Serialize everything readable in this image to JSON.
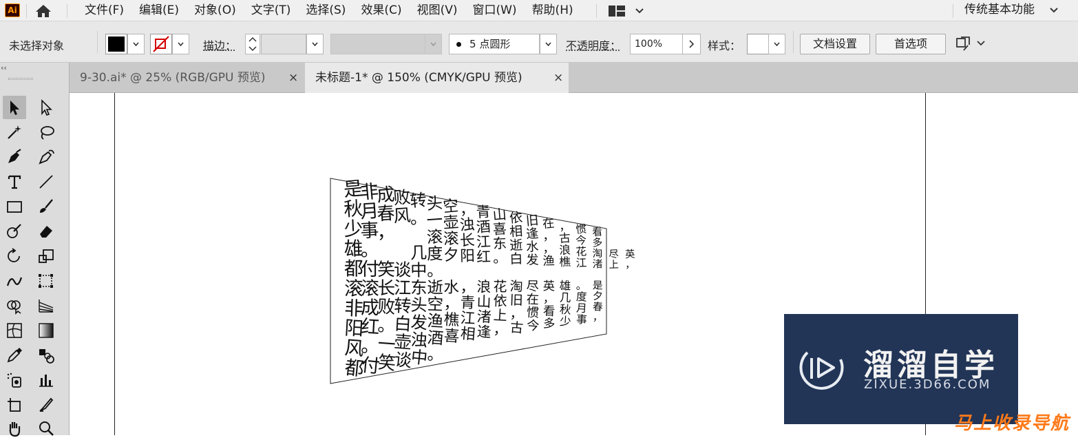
{
  "app": {
    "logo_text": "Ai"
  },
  "menu": {
    "items": [
      "文件(F)",
      "编辑(E)",
      "对象(O)",
      "文字(T)",
      "选择(S)",
      "效果(C)",
      "视图(V)",
      "窗口(W)",
      "帮助(H)"
    ],
    "workspace": "传统基本功能"
  },
  "control": {
    "selection_status": "未选择对象",
    "stroke_label": "描边：",
    "brush_point": "5",
    "brush_label": "点圆形",
    "opacity_label": "不透明度：",
    "opacity_value": "100%",
    "style_label": "样式：",
    "doc_setup_button": "文档设置",
    "preferences_button": "首选项",
    "fill_color": "#000000",
    "stroke_none_color": "#d40000"
  },
  "toolbar": {
    "collapse": "‹‹"
  },
  "tabs": [
    {
      "label": "9-30.ai* @ 25% (RGB/GPU 预览)",
      "close": "×",
      "active": false
    },
    {
      "label": "未标题-1* @ 150% (CMYK/GPU 预览)",
      "close": "×",
      "active": true
    }
  ],
  "canvas": {
    "text_lines": [
      "是非成败转头空，青山依旧在，惯看",
      "秋月春风。一壶浊酒喜相逢，古今多",
      "少事，  滚滚长江东逝水，浪花淘尽英",
      "雄。  几度夕阳红。白发渔樵江渚上，",
      "都付笑谈中。",
      "滚滚长江东逝水，浪花淘尽英雄。是",
      "非成败转头空，青山依旧在，几度夕",
      "阳红。白发渔樵江渚上，惯看秋月春",
      "风。一壶浊酒喜相逢，古今多少事，",
      "都付笑谈中。"
    ]
  },
  "watermark": {
    "title": "溜溜自学",
    "url": "ZIXUE.3D66.COM",
    "bottom": "马上收录导航"
  }
}
